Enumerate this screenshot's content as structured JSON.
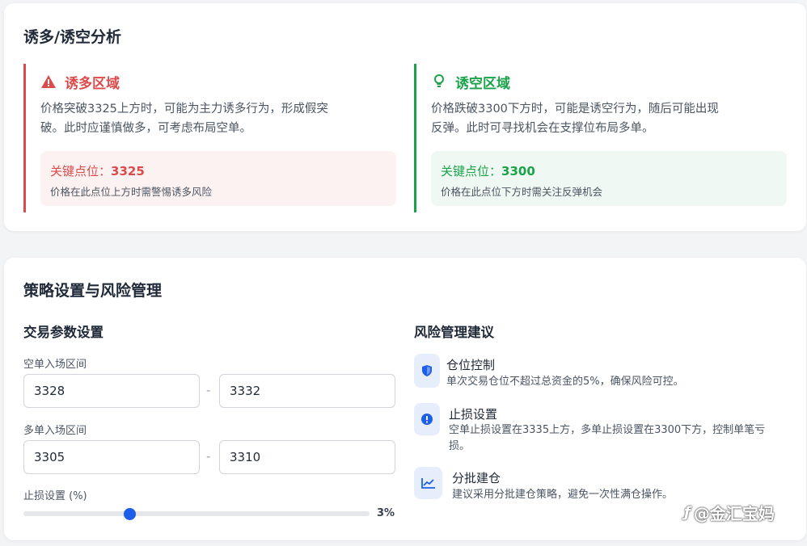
{
  "section1": {
    "title": "诱多/诱空分析",
    "bull_zone": {
      "title": "诱多区域",
      "icon": "warning-triangle-icon",
      "color": "#dc4b4b",
      "desc": "价格突破3325上方时，可能为主力诱多行为，形成假突破。此时应谨慎做多，可考虑布局空单。",
      "key_label": "关键点位：",
      "key_value": "3325",
      "key_note": "价格在此点位上方时需警惕诱多风险"
    },
    "bear_zone": {
      "title": "诱空区域",
      "icon": "lightbulb-icon",
      "color": "#1aa34a",
      "desc": "价格跌破3300下方时，可能是诱空行为，随后可能出现反弹。此时可寻找机会在支撑位布局多单。",
      "key_label": "关键点位：",
      "key_value": "3300",
      "key_note": "价格在此点位下方时需关注反弹机会"
    }
  },
  "section2": {
    "title": "策略设置与风险管理",
    "params": {
      "title": "交易参数设置",
      "short_label": "空单入场区间",
      "short_from": "3328",
      "short_to": "3332",
      "long_label": "多单入场区间",
      "long_from": "3305",
      "long_to": "3310",
      "range_sep": "-",
      "stop_label": "止损设置 (%)",
      "stop_value": 3,
      "stop_value_text": "3%"
    },
    "risk": {
      "title": "风险管理建议",
      "accent": "#1d5fe8",
      "items": [
        {
          "icon": "shield-icon",
          "title": "仓位控制",
          "desc": "单次交易仓位不超过总资金的5%，确保风险可控。"
        },
        {
          "icon": "alert-circle-icon",
          "title": "止损设置",
          "desc": "空单止损设置在3335上方，多单止损设置在3300下方，控制单笔亏损。"
        },
        {
          "icon": "chart-line-icon",
          "title": "分批建仓",
          "desc": "建议采用分批建仓策略，避免一次性满仓操作。"
        }
      ]
    }
  },
  "watermark": "@金汇宝妈"
}
